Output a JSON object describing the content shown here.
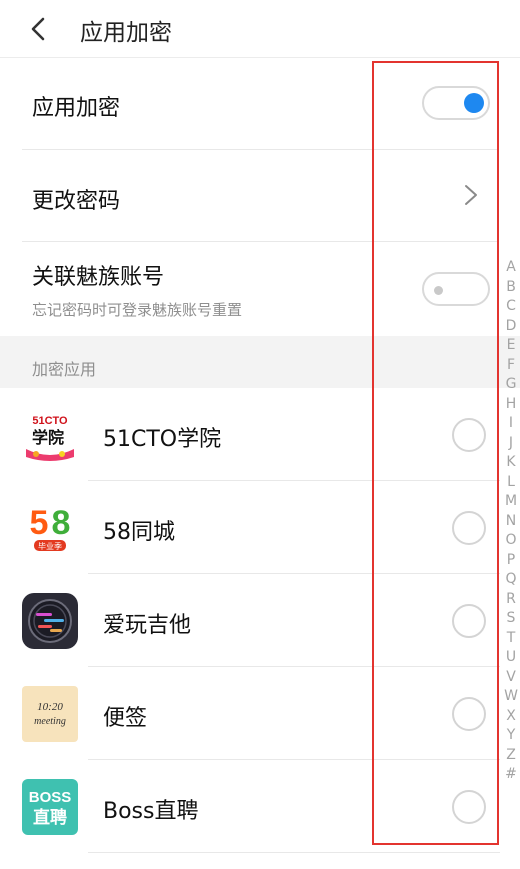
{
  "header": {
    "title": "应用加密"
  },
  "settings": {
    "app_lock": {
      "label": "应用加密",
      "enabled": true
    },
    "change_password": {
      "label": "更改密码"
    },
    "link_account": {
      "label": "关联魅族账号",
      "subtitle": "忘记密码时可登录魅族账号重置",
      "enabled": false
    }
  },
  "section": {
    "title": "加密应用"
  },
  "apps": [
    {
      "name": "51CTO学院",
      "icon": "51cto-icon",
      "icon_text": "51CTO",
      "icon_text2": "学院",
      "selected": false
    },
    {
      "name": "58同城",
      "icon": "58-icon",
      "icon_text": "58",
      "icon_text2": "毕业季",
      "selected": false
    },
    {
      "name": "爱玩吉他",
      "icon": "guitar-icon",
      "selected": false
    },
    {
      "name": "便签",
      "icon": "notes-icon",
      "icon_text": "10:20",
      "icon_text2": "meeting",
      "selected": false
    },
    {
      "name": "Boss直聘",
      "icon": "boss-icon",
      "icon_text": "BOSS",
      "icon_text2": "直聘",
      "selected": false
    }
  ],
  "alphabet": [
    "A",
    "B",
    "C",
    "D",
    "E",
    "F",
    "G",
    "H",
    "I",
    "J",
    "K",
    "L",
    "M",
    "N",
    "O",
    "P",
    "Q",
    "R",
    "S",
    "T",
    "U",
    "V",
    "W",
    "X",
    "Y",
    "Z",
    "#"
  ],
  "colors": {
    "accent": "#1e88f0",
    "highlight": "#e3342f",
    "section_bg": "#f3f3f3"
  }
}
